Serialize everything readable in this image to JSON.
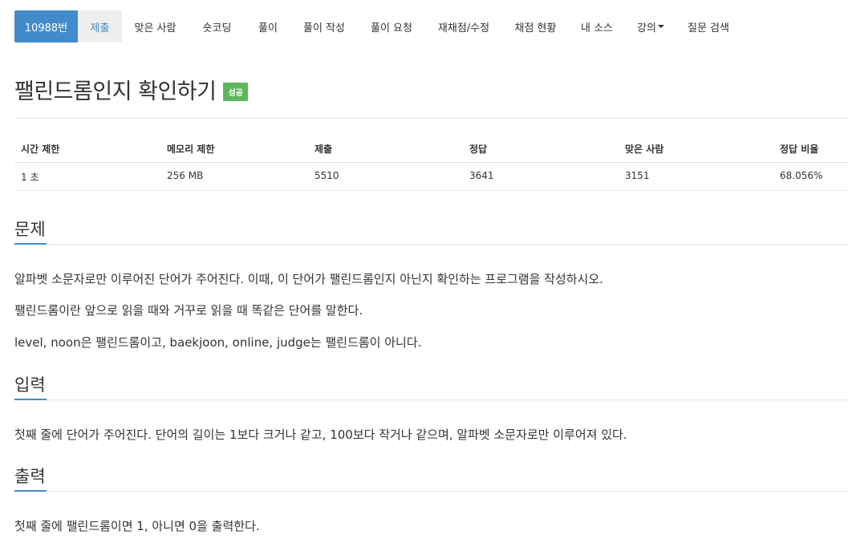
{
  "nav": {
    "items": [
      {
        "label": "10988번"
      },
      {
        "label": "제출"
      },
      {
        "label": "맞은 사람"
      },
      {
        "label": "숏코딩"
      },
      {
        "label": "풀이"
      },
      {
        "label": "풀이 작성"
      },
      {
        "label": "풀이 요청"
      },
      {
        "label": "재채점/수정"
      },
      {
        "label": "채점 현황"
      },
      {
        "label": "내 소스"
      },
      {
        "label": "강의"
      },
      {
        "label": "질문 검색"
      }
    ]
  },
  "problem": {
    "title": "팰린드롬인지 확인하기",
    "badge": "성공"
  },
  "info_table": {
    "headers": [
      "시간 제한",
      "메모리 제한",
      "제출",
      "정답",
      "맞은 사람",
      "정답 비율"
    ],
    "values": [
      "1 초",
      "256 MB",
      "5510",
      "3641",
      "3151",
      "68.056%"
    ]
  },
  "sections": {
    "description": {
      "title": "문제",
      "paragraphs": [
        "알파벳 소문자로만 이루어진 단어가 주어진다. 이때, 이 단어가 팰린드롬인지 아닌지 확인하는 프로그램을 작성하시오.",
        "팰린드롬이란 앞으로 읽을 때와 거꾸로 읽을 때 똑같은 단어를 말한다.",
        "level, noon은 팰린드롬이고, baekjoon, online, judge는 팰린드롬이 아니다."
      ]
    },
    "input": {
      "title": "입력",
      "paragraphs": [
        "첫째 줄에 단어가 주어진다. 단어의 길이는 1보다 크거나 같고, 100보다 작거나 같으며, 알파벳 소문자로만 이루어져 있다."
      ]
    },
    "output": {
      "title": "출력",
      "paragraphs": [
        "첫째 줄에 팰린드롬이면 1, 아니면 0을 출력한다."
      ]
    }
  },
  "colors": {
    "primary": "#428bca",
    "success": "#5cb85c",
    "active_tab_bg": "#eeeeee"
  }
}
